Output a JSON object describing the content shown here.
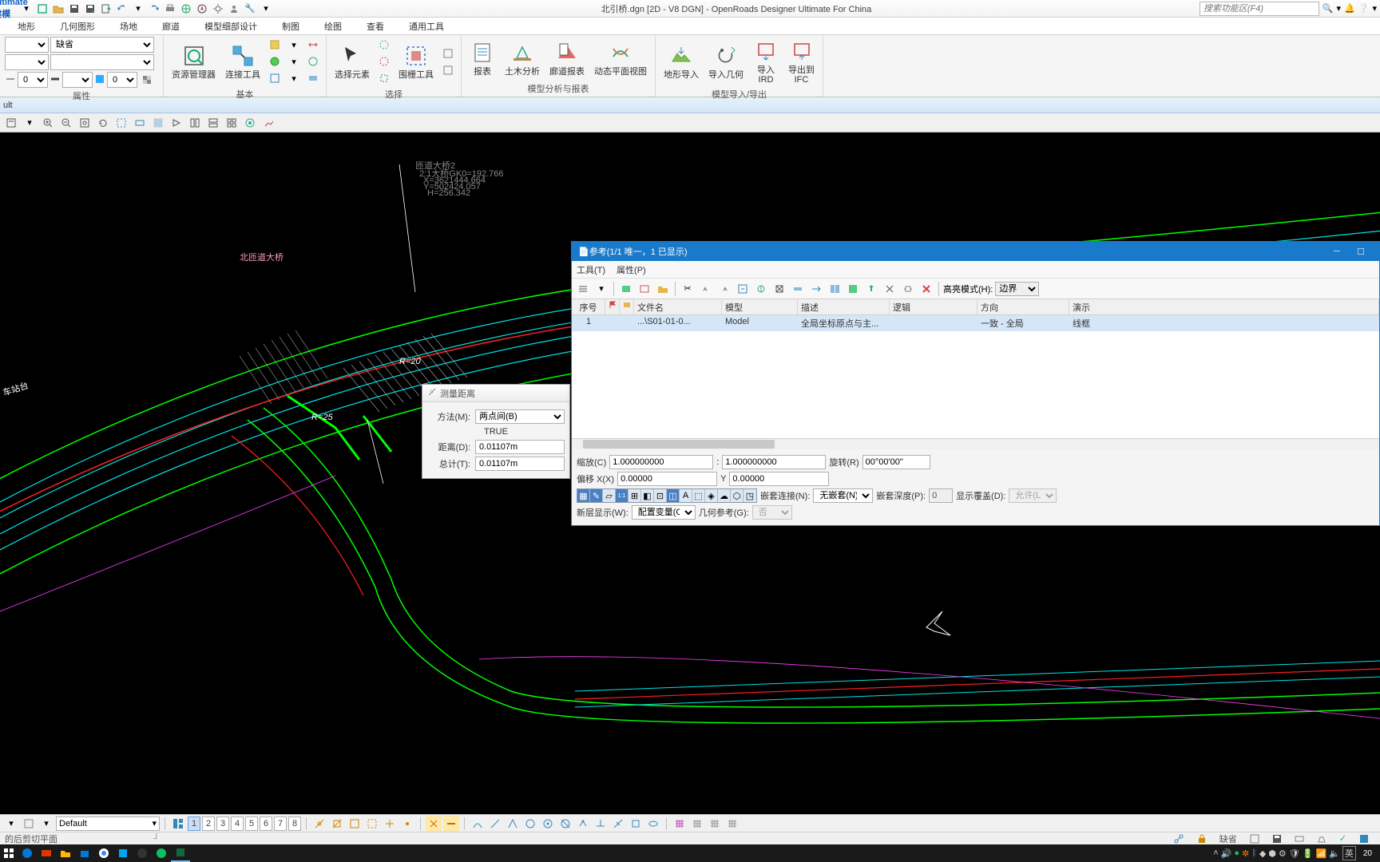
{
  "titlebar": {
    "app_menu": "Ultimate 建模",
    "doc_title": "北引桥.dgn [2D - V8 DGN] - OpenRoads Designer Ultimate For China",
    "search_placeholder": "搜索功能区(F4)"
  },
  "ribbon_tabs": [
    "地形",
    "几何图形",
    "场地",
    "廊道",
    "模型细部设计",
    "制图",
    "绘图",
    "查看",
    "通用工具"
  ],
  "ribbon": {
    "attributes": {
      "label": "属性",
      "level_value": "缺省",
      "num_value": "0",
      "num_value2": "0"
    },
    "basic": {
      "label": "基本",
      "resource_mgr": "资源管理器",
      "connect_tool": "连接工具"
    },
    "select": {
      "label": "选择",
      "select_elem": "选择元素",
      "fence_tool": "围栅工具"
    },
    "model_analysis": {
      "label": "模型分析与报表",
      "report": "报表",
      "civil_analysis": "土木分析",
      "corridor_report": "廊道报表",
      "dynamic_plan": "动态平面视图"
    },
    "model_io": {
      "label": "模型导入/导出",
      "terrain_import": "地形导入",
      "import_geom": "导入几何",
      "import_ird": "导入\nIRD",
      "export_ifc": "导出到\nIFC"
    }
  },
  "sec_header": "ult",
  "measure_dlg": {
    "title": "测量距离",
    "method_label": "方法(M):",
    "method_value": "两点间(B)",
    "true_label": "TRUE",
    "distance_label": "距离(D):",
    "distance_value": "0.01107m",
    "total_label": "总计(T):",
    "total_value": "0.01107m"
  },
  "ref_dlg": {
    "title": "参考(1/1 唯一，1 已显示)",
    "menu": {
      "tools": "工具(T)",
      "properties": "属性(P)"
    },
    "highlight_label": "高亮模式(H):",
    "highlight_value": "边界",
    "columns": [
      "序号",
      "",
      "",
      "文件名",
      "模型",
      "描述",
      "逻辑",
      "方向",
      "演示"
    ],
    "row": {
      "seq": "1",
      "filename": "...\\S01-01-0...",
      "model": "Model",
      "desc": "全局坐标原点与主...",
      "dir": "一致 - 全局",
      "present": "线框"
    },
    "scale_label": "缩放(C)",
    "scale_v1": "1.000000000",
    "scale_v2": "1.000000000",
    "rotation_label": "旋转(R)",
    "rotation_value": "00°00'00\"",
    "offset_label": "偏移 X(X)",
    "offset_x": "0.00000",
    "offset_y_label": "Y",
    "offset_y": "0.00000",
    "nest_conn_label": "嵌套连接(N):",
    "nest_conn_value": "无嵌套(N)",
    "nest_depth_label": "嵌套深度(P):",
    "nest_depth_value": "0",
    "disp_overlay_label": "显示覆盖(D):",
    "disp_overlay_value": "允许(L)",
    "newlevel_label": "新层显示(W):",
    "newlevel_value": "配置变量(C)",
    "geo_ref_label": "几何参考(G):",
    "geo_ref_value": "否"
  },
  "view_controls": {
    "config": "Default",
    "nums": [
      "1",
      "2",
      "3",
      "4",
      "5",
      "6",
      "7",
      "8"
    ]
  },
  "statusbar": {
    "left": "的后剪切平面",
    "level": "缺省",
    "ime": "英",
    "time": "20"
  },
  "canvas_labels": {
    "r20": "R=20",
    "r25": "R=25",
    "station": "车站台"
  }
}
